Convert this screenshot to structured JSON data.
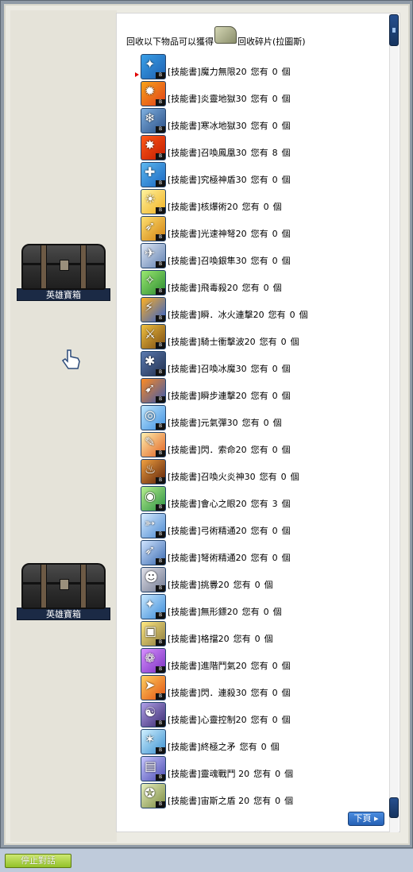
{
  "header": {
    "text_before": "回收以下物品可以獲得",
    "text_after": "回收碎片(拉圖斯)"
  },
  "chests": [
    {
      "label": "英雄寶箱"
    },
    {
      "label": "英雄寶箱"
    }
  ],
  "items": [
    {
      "name": "[技能書]魔力無限20",
      "owned_prefix": "您有",
      "count": "0",
      "unit": "個",
      "icon": "rune-icon",
      "colors": [
        "#3aa0e8",
        "#1d5fb0"
      ]
    },
    {
      "name": "[技能書]炎靈地獄30",
      "owned_prefix": "您有",
      "count": "0",
      "unit": "個",
      "icon": "fire-icon",
      "colors": [
        "#f7a21a",
        "#e0401a"
      ]
    },
    {
      "name": "[技能書]寒冰地獄30",
      "owned_prefix": "您有",
      "count": "0",
      "unit": "個",
      "icon": "ice-icon",
      "colors": [
        "#7fb0e0",
        "#2a4f86"
      ]
    },
    {
      "name": "[技能書]召喚鳳凰30",
      "owned_prefix": "您有",
      "count": "8",
      "unit": "個",
      "icon": "phoenix-icon",
      "colors": [
        "#ff5a1a",
        "#c01a00"
      ]
    },
    {
      "name": "[技能書]究極神盾30",
      "owned_prefix": "您有",
      "count": "0",
      "unit": "個",
      "icon": "shield-icon",
      "colors": [
        "#5cb8f0",
        "#1a66c0"
      ]
    },
    {
      "name": "[技能書]核爆術20",
      "owned_prefix": "您有",
      "count": "0",
      "unit": "個",
      "icon": "explosion-icon",
      "colors": [
        "#fff3a0",
        "#f0b020"
      ]
    },
    {
      "name": "[技能書]光速神弩20",
      "owned_prefix": "您有",
      "count": "0",
      "unit": "個",
      "icon": "crossbow-icon",
      "colors": [
        "#ffe070",
        "#d08010"
      ]
    },
    {
      "name": "[技能書]召喚銀隼30",
      "owned_prefix": "您有",
      "count": "0",
      "unit": "個",
      "icon": "falcon-icon",
      "colors": [
        "#dfe8f5",
        "#5f7fb0"
      ]
    },
    {
      "name": "[技能書]飛毒殺20",
      "owned_prefix": "您有",
      "count": "0",
      "unit": "個",
      "icon": "poison-star-icon",
      "colors": [
        "#9ae870",
        "#2a8a30"
      ]
    },
    {
      "name": "[技能書]瞬．冰火連擊20",
      "owned_prefix": "您有",
      "count": "0",
      "unit": "個",
      "icon": "fire-ice-icon",
      "colors": [
        "#ffb020",
        "#3060d0"
      ]
    },
    {
      "name": "[技能書]騎士衝擊波20",
      "owned_prefix": "您有",
      "count": "0",
      "unit": "個",
      "icon": "knight-icon",
      "colors": [
        "#f0c040",
        "#7a4a10"
      ]
    },
    {
      "name": "[技能書]召喚冰魔30",
      "owned_prefix": "您有",
      "count": "0",
      "unit": "個",
      "icon": "ice-demon-icon",
      "colors": [
        "#5a7ab0",
        "#22304f"
      ]
    },
    {
      "name": "[技能書]瞬步連擊20",
      "owned_prefix": "您有",
      "count": "0",
      "unit": "個",
      "icon": "combo-icon",
      "colors": [
        "#ff8a20",
        "#3a5ab0"
      ]
    },
    {
      "name": "[技能書]元氣彈30",
      "owned_prefix": "您有",
      "count": "0",
      "unit": "個",
      "icon": "energy-orb-icon",
      "colors": [
        "#bfe7ff",
        "#3f90e0"
      ]
    },
    {
      "name": "[技能書]閃．索命20",
      "owned_prefix": "您有",
      "count": "0",
      "unit": "個",
      "icon": "slash-icon",
      "colors": [
        "#fff0b0",
        "#e06020"
      ]
    },
    {
      "name": "[技能書]召喚火炎神30",
      "owned_prefix": "您有",
      "count": "0",
      "unit": "個",
      "icon": "flame-god-icon",
      "colors": [
        "#f0a040",
        "#5a2008"
      ]
    },
    {
      "name": "[技能書]會心之眼20",
      "owned_prefix": "您有",
      "count": "3",
      "unit": "個",
      "icon": "eye-icon",
      "colors": [
        "#b8f090",
        "#2a9040"
      ]
    },
    {
      "name": "[技能書]弓術精通20",
      "owned_prefix": "您有",
      "count": "0",
      "unit": "個",
      "icon": "bow-icon",
      "colors": [
        "#d8ecff",
        "#4a88d0"
      ]
    },
    {
      "name": "[技能書]弩術精通20",
      "owned_prefix": "您有",
      "count": "0",
      "unit": "個",
      "icon": "crossbow-mastery-icon",
      "colors": [
        "#d0e4ff",
        "#3a6ab0"
      ]
    },
    {
      "name": "[技能書]挑釁20",
      "owned_prefix": "您有",
      "count": "0",
      "unit": "個",
      "icon": "taunt-icon",
      "colors": [
        "#e0e0e8",
        "#707890"
      ]
    },
    {
      "name": "[技能書]無形鏢20",
      "owned_prefix": "您有",
      "count": "0",
      "unit": "個",
      "icon": "shuriken-icon",
      "colors": [
        "#c8e8ff",
        "#3a8ad8"
      ]
    },
    {
      "name": "[技能書]格擋20",
      "owned_prefix": "您有",
      "count": "0",
      "unit": "個",
      "icon": "guard-icon",
      "colors": [
        "#ffe880",
        "#8a7a40"
      ]
    },
    {
      "name": "[技能書]進階鬥氣20",
      "owned_prefix": "您有",
      "count": "0",
      "unit": "個",
      "icon": "combo-orb-icon",
      "colors": [
        "#d890ff",
        "#7a30c0"
      ]
    },
    {
      "name": "[技能書]閃．連殺30",
      "owned_prefix": "您有",
      "count": "0",
      "unit": "個",
      "icon": "dash-icon",
      "colors": [
        "#ffd060",
        "#e05010"
      ]
    },
    {
      "name": "[技能書]心靈控制20",
      "owned_prefix": "您有",
      "count": "0",
      "unit": "個",
      "icon": "mind-control-icon",
      "colors": [
        "#b0a0e8",
        "#3a2a70"
      ]
    },
    {
      "name": "[技能書]終極之矛",
      "owned_prefix": "您有",
      "count": "0",
      "unit": "個",
      "icon": "dragon-spear-icon",
      "colors": [
        "#d0f0ff",
        "#3a90d0"
      ]
    },
    {
      "name": "[技能書]靈魂戰鬥 20",
      "owned_prefix": "您有",
      "count": "0",
      "unit": "個",
      "icon": "soul-icon",
      "colors": [
        "#c8c8ff",
        "#4a4ab0"
      ]
    },
    {
      "name": "[技能書]宙斯之盾 20",
      "owned_prefix": "您有",
      "count": "0",
      "unit": "個",
      "icon": "zeus-shield-icon",
      "colors": [
        "#e8f0c0",
        "#7a8a40"
      ]
    }
  ],
  "pagination": {
    "next_label": "下頁 ▸"
  },
  "footer": {
    "stop_label": "停止對話"
  }
}
